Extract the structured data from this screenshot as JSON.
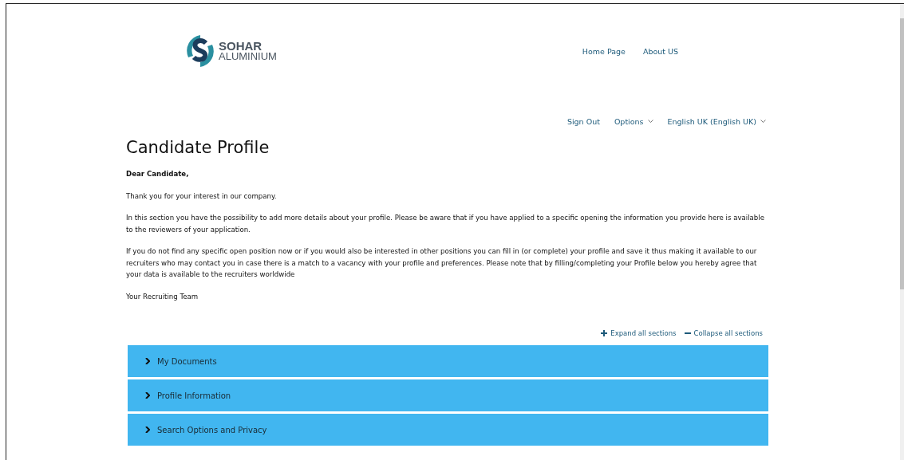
{
  "header": {
    "logo": {
      "line_1": "SOHAR",
      "line_2": "ALUMINIUM"
    },
    "nav": [
      "Home Page",
      "About US"
    ]
  },
  "user_menu": [
    {
      "label": "Sign Out",
      "kind": "link"
    },
    {
      "label": "Options",
      "kind": "dropdown"
    },
    {
      "label": "English UK (English UK)",
      "kind": "dropdown"
    }
  ],
  "title": "Candidate Profile",
  "intro": [
    {
      "text": "Dear Candidate,",
      "kind": "bold"
    },
    {
      "text": "Thank you for your interest in our company.",
      "kind": "plain"
    },
    {
      "text": "In this section you have the possibility to add more details about your profile. Please be aware that if you have applied to a specific opening the information you provide here is available to the reviewers of your application.",
      "kind": "plain"
    },
    {
      "text": "If you do not find any specific open position now or if you would also be interested in other positions you can fill in (or complete) your profile and save it thus making it available to our recruiters who may contact you in case there is a match to a vacancy with your profile and preferences. Please note that by filling/completing your Profile below you hereby agree that your data is available to the recruiters worldwide",
      "kind": "plain"
    },
    {
      "text": "Your Recruiting Team",
      "kind": "plain"
    }
  ],
  "section_controls": [
    {
      "label": "Expand all sections",
      "kind": "expand"
    },
    {
      "label": "Collapse all sections",
      "kind": "collapse"
    }
  ],
  "sections": [
    {
      "label": "My Documents",
      "expanded": false
    },
    {
      "label": "Profile Information",
      "expanded": false
    },
    {
      "label": "Search Options and Privacy",
      "expanded": false
    }
  ]
}
